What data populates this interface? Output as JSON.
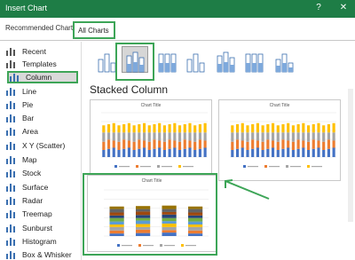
{
  "window": {
    "title": "Insert Chart",
    "help": "?",
    "close": "✕"
  },
  "tabs": {
    "recommended": "Recommended Charts",
    "all": "All Charts"
  },
  "sidebar": {
    "items": [
      {
        "label": "Recent",
        "icon": "recent-icon"
      },
      {
        "label": "Templates",
        "icon": "templates-icon"
      },
      {
        "label": "Column",
        "icon": "column-chart-icon"
      },
      {
        "label": "Line",
        "icon": "line-chart-icon"
      },
      {
        "label": "Pie",
        "icon": "pie-chart-icon"
      },
      {
        "label": "Bar",
        "icon": "bar-chart-icon"
      },
      {
        "label": "Area",
        "icon": "area-chart-icon"
      },
      {
        "label": "X Y (Scatter)",
        "icon": "scatter-chart-icon"
      },
      {
        "label": "Map",
        "icon": "map-chart-icon"
      },
      {
        "label": "Stock",
        "icon": "stock-chart-icon"
      },
      {
        "label": "Surface",
        "icon": "surface-chart-icon"
      },
      {
        "label": "Radar",
        "icon": "radar-chart-icon"
      },
      {
        "label": "Treemap",
        "icon": "treemap-chart-icon"
      },
      {
        "label": "Sunburst",
        "icon": "sunburst-chart-icon"
      },
      {
        "label": "Histogram",
        "icon": "histogram-chart-icon"
      },
      {
        "label": "Box & Whisker",
        "icon": "box-whisker-chart-icon"
      }
    ],
    "selected": "Column"
  },
  "subtypes": [
    "clustered-column",
    "stacked-column",
    "100-stacked-column",
    "3d-clustered-column",
    "3d-stacked-column",
    "3d-100-stacked-column",
    "3d-column"
  ],
  "selected_subtype_title": "Stacked Column",
  "previews": [
    {
      "title": "Chart Title"
    },
    {
      "title": "Chart Title"
    },
    {
      "title": "Chart Title"
    }
  ],
  "colors": {
    "accent": "#3da557",
    "titlebar": "#1e7d46",
    "series": [
      "#4472c4",
      "#ed7d31",
      "#a5a5a5",
      "#ffc000",
      "#5b9bd5",
      "#70ad47",
      "#264478",
      "#9e480e",
      "#636363",
      "#997300"
    ]
  },
  "chart_data": [
    {
      "type": "bar",
      "title": "Chart Title",
      "stacked": true,
      "bars": 21,
      "series_count": 4
    },
    {
      "type": "bar",
      "title": "Chart Title",
      "stacked": true,
      "bars": 21,
      "series_count": 4
    },
    {
      "type": "bar",
      "title": "Chart Title",
      "stacked": true,
      "bars": 4,
      "series_count": 10
    }
  ]
}
